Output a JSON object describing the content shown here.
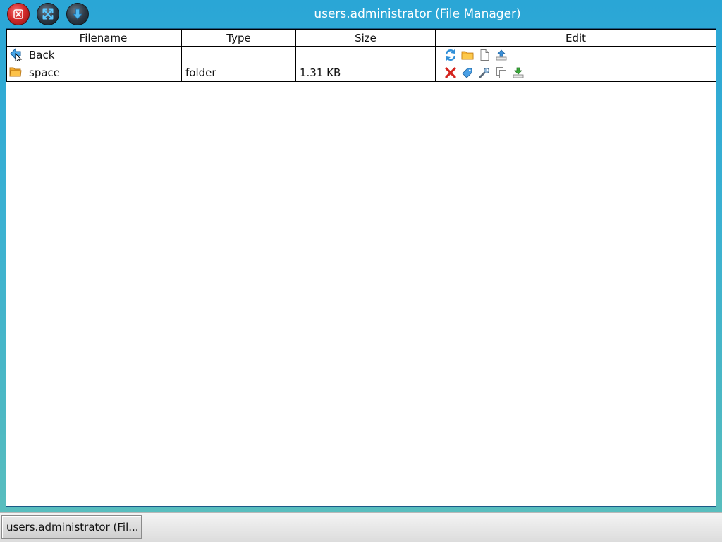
{
  "window": {
    "title": "users.administrator (File Manager)"
  },
  "table": {
    "columns": [
      "",
      "Filename",
      "Type",
      "Size",
      "Edit"
    ],
    "rows": [
      {
        "icon": "back-arrow-icon",
        "filename": "Back",
        "type": "",
        "size": "",
        "actions": [
          "refresh-icon",
          "new-folder-icon",
          "new-file-icon",
          "upload-icon"
        ]
      },
      {
        "icon": "folder-icon",
        "filename": "space",
        "type": "folder",
        "size": "1.31 KB",
        "actions": [
          "delete-icon",
          "rename-icon",
          "properties-icon",
          "copy-icon",
          "download-icon"
        ]
      }
    ]
  },
  "taskbar": {
    "task_label": "users.administrator (Fil..."
  },
  "colors": {
    "desktop": "#3bb1d2",
    "close_button": "#d42b2b",
    "title_text": "#ffffff"
  }
}
